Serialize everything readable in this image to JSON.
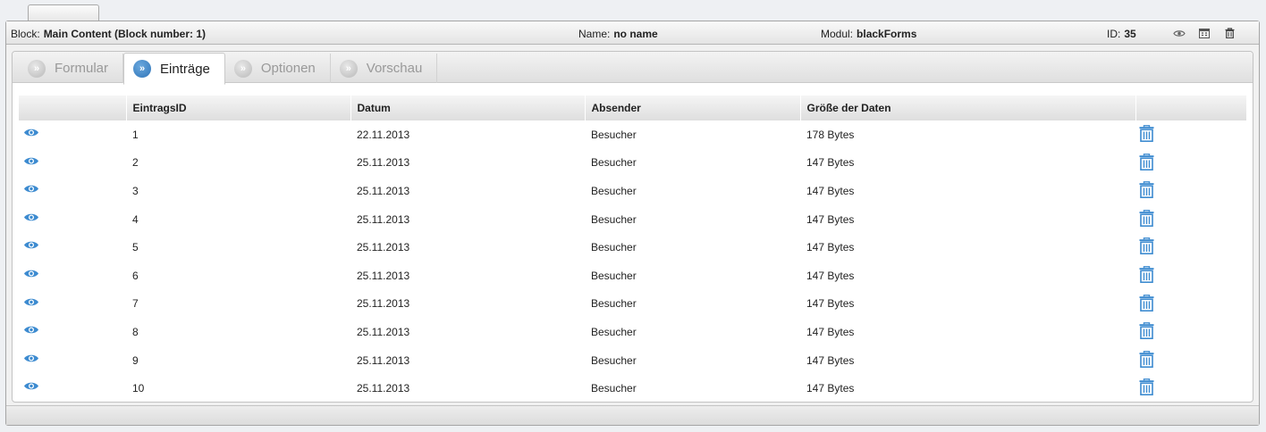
{
  "block": {
    "block_label": "Block:",
    "block_value": "Main Content (Block number: 1)",
    "name_label": "Name:",
    "name_value": "no name",
    "modul_label": "Modul:",
    "modul_value": "blackForms",
    "id_label": "ID:",
    "id_value": "35",
    "icons": [
      "eye-icon",
      "calendar-icon",
      "trash-icon"
    ]
  },
  "tabs": [
    {
      "label": "Formular",
      "active": false
    },
    {
      "label": "Einträge",
      "active": true
    },
    {
      "label": "Optionen",
      "active": false
    },
    {
      "label": "Vorschau",
      "active": false
    }
  ],
  "table": {
    "columns": [
      "",
      "EintragsID",
      "Datum",
      "Absender",
      "Größe der Daten",
      ""
    ],
    "rows": [
      {
        "id": "1",
        "date": "22.11.2013",
        "sender": "Besucher",
        "size": "178 Bytes"
      },
      {
        "id": "2",
        "date": "25.11.2013",
        "sender": "Besucher",
        "size": "147 Bytes"
      },
      {
        "id": "3",
        "date": "25.11.2013",
        "sender": "Besucher",
        "size": "147 Bytes"
      },
      {
        "id": "4",
        "date": "25.11.2013",
        "sender": "Besucher",
        "size": "147 Bytes"
      },
      {
        "id": "5",
        "date": "25.11.2013",
        "sender": "Besucher",
        "size": "147 Bytes"
      },
      {
        "id": "6",
        "date": "25.11.2013",
        "sender": "Besucher",
        "size": "147 Bytes"
      },
      {
        "id": "7",
        "date": "25.11.2013",
        "sender": "Besucher",
        "size": "147 Bytes"
      },
      {
        "id": "8",
        "date": "25.11.2013",
        "sender": "Besucher",
        "size": "147 Bytes"
      },
      {
        "id": "9",
        "date": "25.11.2013",
        "sender": "Besucher",
        "size": "147 Bytes"
      },
      {
        "id": "10",
        "date": "25.11.2013",
        "sender": "Besucher",
        "size": "147 Bytes"
      }
    ]
  },
  "colors": {
    "accent_blue": "#3d8bd0",
    "tab_active_icon": "#2f74b8",
    "header_gradient_top": "#f9f9f9",
    "header_gradient_bottom": "#e4e4e4"
  }
}
